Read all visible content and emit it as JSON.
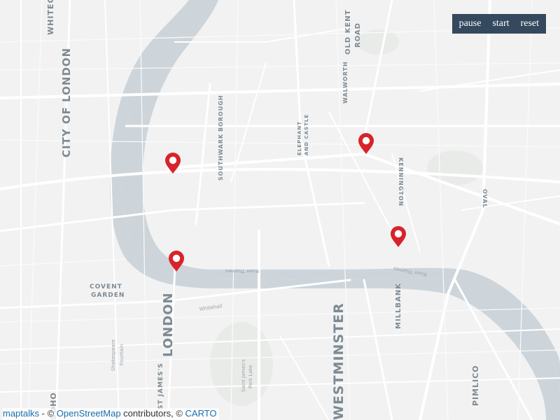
{
  "toolbar": {
    "pause_label": "pause",
    "start_label": "start",
    "reset_label": "reset"
  },
  "map": {
    "river_color": "#cdd5db",
    "land_color": "#f2f2f2",
    "road_color": "#ffffff",
    "marker_color": "#d8232a",
    "area_labels": {
      "city_of_london": "CITY OF LONDON",
      "london": "LONDON",
      "westminster": "WESTMINSTER",
      "covent_garden_1": "COVENT",
      "covent_garden_2": "GARDEN",
      "millbank": "MILLBANK",
      "pimlico": "PIMLICO",
      "southwark": "SOUTHWARK",
      "borough": "BOROUGH",
      "kennington": "KENNINGTON",
      "oval": "OVAL",
      "old_kent_road_1": "OLD KENT",
      "old_kent_road_2": "ROAD",
      "elephant_1": "ELEPHANT",
      "elephant_2": "AND CASTLE",
      "walworth": "WALWORTH",
      "whitechapel": "WHITECHAPEL",
      "st_james_1": "Saint James's",
      "st_james_2": "Park Lake",
      "shakespeare_1": "Shakespeare",
      "shakespeare_2": "Fountain",
      "whitehall": "Whitehall",
      "river_thames_1": "River Thames",
      "river_thames_2": "River Thames",
      "soho": "SOHO",
      "st_james_area": "ST JAMES'S"
    },
    "markers": [
      {
        "name": "marker-1"
      },
      {
        "name": "marker-2"
      },
      {
        "name": "marker-3"
      },
      {
        "name": "marker-4"
      }
    ]
  },
  "attribution": {
    "maptalks": "maptalks",
    "sep1": " - © ",
    "osm": "OpenStreetMap",
    "sep2": " contributors, © ",
    "carto": "CARTO"
  }
}
